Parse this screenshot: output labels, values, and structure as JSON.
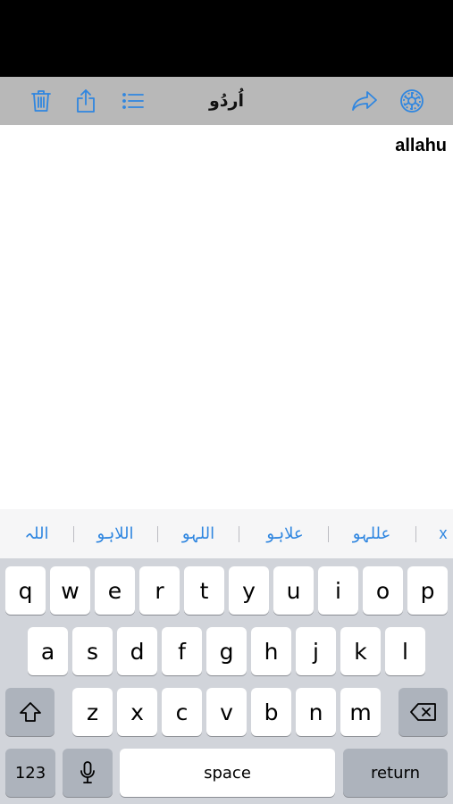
{
  "toolbar": {
    "title": "اُردُو",
    "icons": [
      "trash-icon",
      "share-icon",
      "list-icon",
      "forward-icon",
      "settings-icon"
    ],
    "accent": "#2f86e0"
  },
  "editor": {
    "text": "allahu"
  },
  "suggestions": {
    "close_label": "x",
    "items": [
      "عللہو",
      "علاہو",
      "اللہو",
      "اللاہو",
      "اللہ"
    ]
  },
  "keyboard": {
    "row1": [
      "q",
      "w",
      "e",
      "r",
      "t",
      "y",
      "u",
      "i",
      "o",
      "p"
    ],
    "row2": [
      "a",
      "s",
      "d",
      "f",
      "g",
      "h",
      "j",
      "k",
      "l"
    ],
    "row3": [
      "z",
      "x",
      "c",
      "v",
      "b",
      "n",
      "m"
    ],
    "numbers_label": "123",
    "space_label": "space",
    "return_label": "return",
    "icons": [
      "shift-icon",
      "backspace-icon",
      "microphone-icon"
    ]
  }
}
